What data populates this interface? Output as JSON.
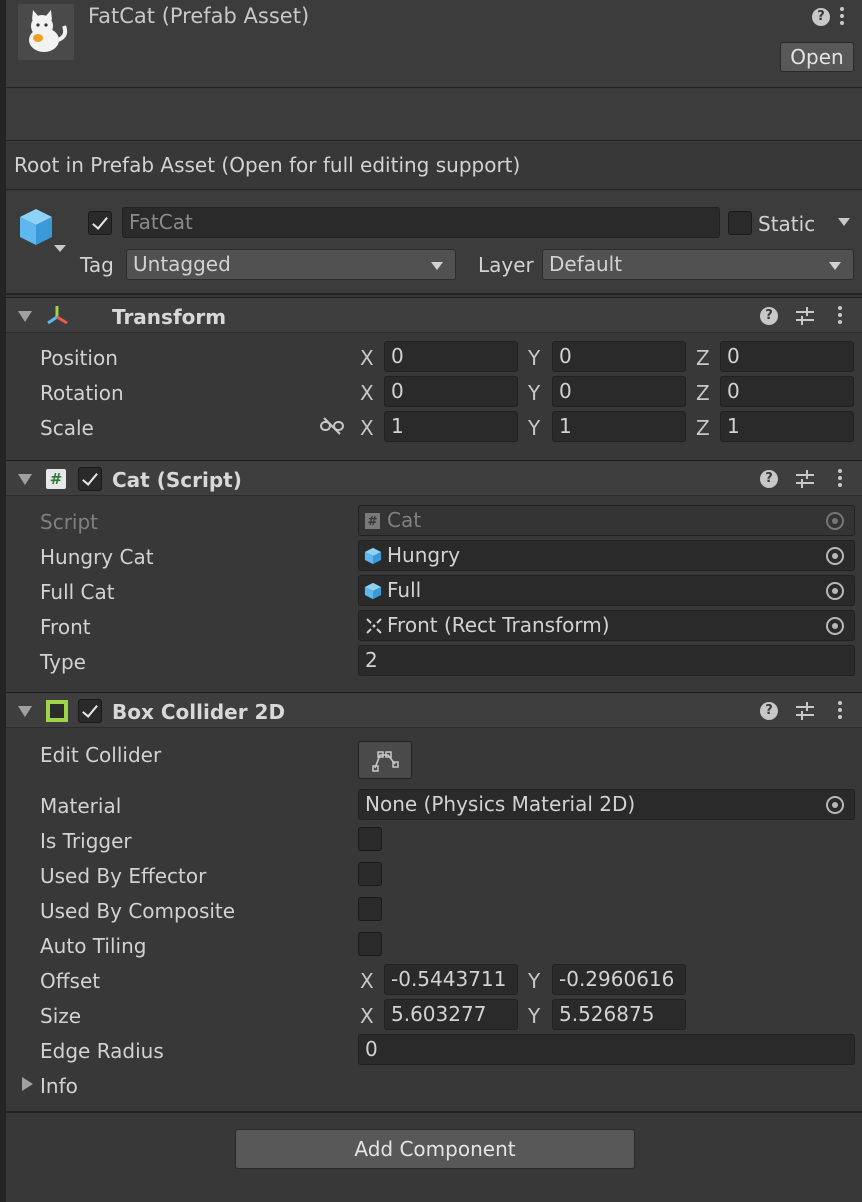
{
  "header": {
    "title": "FatCat (Prefab Asset)",
    "open_label": "Open"
  },
  "prefab_note": "Root in Prefab Asset (Open for full editing support)",
  "gameobject": {
    "enabled": true,
    "name": "FatCat",
    "static_label": "Static",
    "static_checked": false,
    "tag_label": "Tag",
    "tag_value": "Untagged",
    "layer_label": "Layer",
    "layer_value": "Default"
  },
  "transform": {
    "title": "Transform",
    "rows": [
      {
        "label": "Position",
        "x": "0",
        "y": "0",
        "z": "0"
      },
      {
        "label": "Rotation",
        "x": "0",
        "y": "0",
        "z": "0"
      },
      {
        "label": "Scale",
        "x": "1",
        "y": "1",
        "z": "1"
      }
    ],
    "axes": [
      "X",
      "Y",
      "Z"
    ]
  },
  "cat_script": {
    "title": "Cat (Script)",
    "enabled": true,
    "script_label": "Script",
    "script_value": "Cat",
    "hungry_label": "Hungry Cat",
    "hungry_value": "Hungry",
    "full_label": "Full Cat",
    "full_value": "Full",
    "front_label": "Front",
    "front_value": "Front (Rect Transform)",
    "type_label": "Type",
    "type_value": "2"
  },
  "box_collider": {
    "title": "Box Collider 2D",
    "enabled": true,
    "edit_collider_label": "Edit Collider",
    "material_label": "Material",
    "material_value": "None (Physics Material 2D)",
    "is_trigger_label": "Is Trigger",
    "used_by_effector_label": "Used By Effector",
    "used_by_composite_label": "Used By Composite",
    "auto_tiling_label": "Auto Tiling",
    "offset_label": "Offset",
    "offset_x": "-0.5443711",
    "offset_y": "-0.2960616",
    "size_label": "Size",
    "size_x": "5.603277",
    "size_y": "5.526875",
    "edge_radius_label": "Edge Radius",
    "edge_radius_value": "0",
    "info_label": "Info"
  },
  "add_component_label": "Add Component",
  "colors": {
    "panel_bg": "#383838",
    "field_bg": "#2a2a2a",
    "header_bg": "#3e3e3e",
    "text": "#d2d2d2",
    "cube_blue": "#5db8f0",
    "collider_green": "#9cd44a"
  }
}
